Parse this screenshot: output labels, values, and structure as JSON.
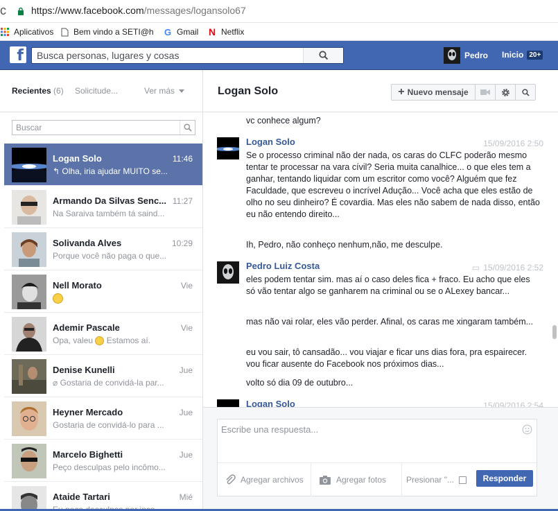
{
  "browser": {
    "url_host": "https://www.facebook.com",
    "url_path": "/messages/logansolo67",
    "bookmarks": [
      {
        "label": "Aplicativos",
        "icon": "apps-grid-icon"
      },
      {
        "label": "Bem vindo a SETI@hc",
        "icon": "page-icon"
      },
      {
        "label": "Gmail",
        "icon": "google-icon"
      },
      {
        "label": "Netflix",
        "icon": "netflix-icon"
      }
    ]
  },
  "topbar": {
    "search_placeholder": "Busca personas, lugares y cosas",
    "user_name": "Pedro",
    "home_label": "Inicio",
    "home_badge": "20+"
  },
  "sidebar": {
    "recent_label": "Recientes",
    "recent_count": "(6)",
    "requests_label": "Solicitude...",
    "more_label": "Ver más",
    "search_placeholder": "Buscar",
    "conversations": [
      {
        "name": "Logan Solo",
        "time": "11:46",
        "snippet": "↰ Olha, iria ajudar MUITO se...",
        "selected": true
      },
      {
        "name": "Armando Da Silvas Senc...",
        "time": "11:27",
        "snippet": "Na Saraiva também tá saind..."
      },
      {
        "name": "Solivanda Alves",
        "time": "10:29",
        "snippet": "Porque você não paga o que..."
      },
      {
        "name": "Nell Morato",
        "time": "Vie",
        "snippet": ""
      },
      {
        "name": "Ademir Pascale",
        "time": "Vie",
        "snippet": "Opa, valeu",
        "snippet_after": " Estamos aí."
      },
      {
        "name": "Denise Kunelli",
        "time": "Jue",
        "snippet": "Gostaria de convidá-la par..."
      },
      {
        "name": "Heyner Mercado",
        "time": "Jue",
        "snippet": "Gostaria de convidá-lo para ..."
      },
      {
        "name": "Marcelo Bighetti",
        "time": "Jue",
        "snippet": "Peço desculpas pelo incômo..."
      },
      {
        "name": "Ataide Tartari",
        "time": "Mié",
        "snippet": "Eu peço desculpas por inco..."
      }
    ]
  },
  "thread": {
    "title": "Logan Solo",
    "new_message_label": "Nuevo mensaje",
    "messages": [
      {
        "text": "vc conhece algum?"
      },
      {
        "sender": "Logan Solo",
        "time": "15/09/2016 2:50",
        "text": "Se o processo criminal não der nada, os caras do CLFC poderão mesmo tentar te processar na vara cívil? Seria muita canalhice... o que eles tem a ganhar, tentando liquidar com um escritor como você? Alguém que fez Faculdade, que escreveu o incrível Adução... Você acha que eles estão de olho no seu dinheiro? É covardia. Mas eles não sabem de nada disso, então eu não entendo direito..."
      },
      {
        "text": "Ih, Pedro, não conheço nenhum,não, me desculpe."
      },
      {
        "sender": "Pedro Luiz Costa",
        "time": "15/09/2016 2:52",
        "text": "eles podem tentar sim. mas aí o caso deles fica + fraco. Eu acho que eles só vão tentar algo se ganharem na criminal ou se o ALexey bancar..."
      },
      {
        "text": "mas não vai rolar, eles vão perder. Afinal, os caras me xingaram também..."
      },
      {
        "text": "eu vou sair, tô cansadão... vou viajar e ficar uns dias fora, pra espairecer. vou ficar ausente do Facebook nos próximos dias..."
      },
      {
        "text": "volto só dia 09 de outubro..."
      },
      {
        "sender": "Logan Solo",
        "time": "15/09/2016 2:54"
      }
    ]
  },
  "composer": {
    "placeholder": "Escribe una respuesta...",
    "attach_label": "Agregar archivos",
    "photo_label": "Agregar fotos",
    "press_label": "Presionar \"...",
    "send_label": "Responder"
  }
}
